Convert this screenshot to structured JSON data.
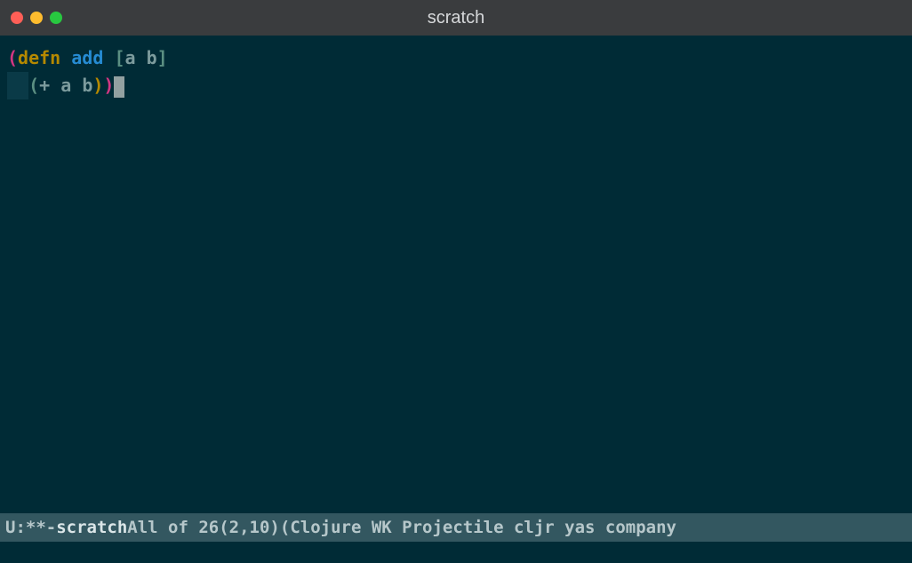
{
  "titlebar": {
    "title": "scratch"
  },
  "code": {
    "line1": {
      "p_open": "(",
      "defn": "defn",
      "sp1": " ",
      "fname": "add",
      "sp2": " ",
      "br_open": "[",
      "a": "a",
      "sp3": " ",
      "b": "b",
      "br_close": "]"
    },
    "line2": {
      "indent": "  ",
      "inner_open": "(",
      "plus": "+",
      "sp1": " ",
      "a": "a",
      "sp2": " ",
      "b": "b",
      "inner_close": ")",
      "outer_close": ")"
    }
  },
  "modeline": {
    "status": "U:**-",
    "buffer": "scratch",
    "position": "All of 26",
    "cursor": "(2,10)",
    "modes": "(Clojure WK Projectile cljr yas company"
  }
}
